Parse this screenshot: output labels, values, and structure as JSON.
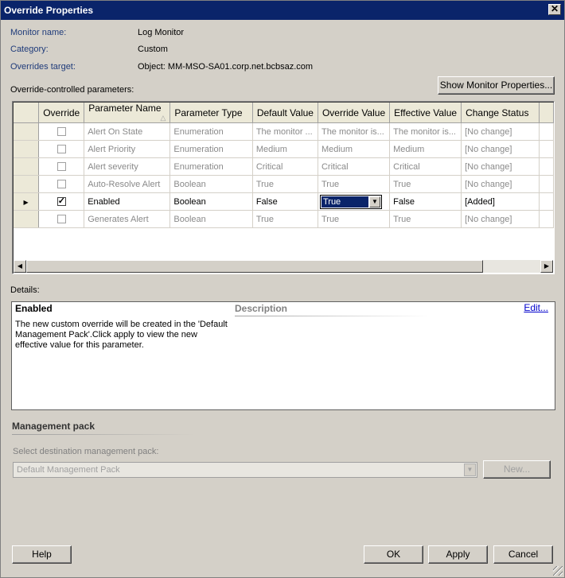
{
  "window": {
    "title": "Override Properties",
    "close_glyph": "✕"
  },
  "info": {
    "monitor_name_label": "Monitor name:",
    "monitor_name_value": "Log Monitor",
    "category_label": "Category:",
    "category_value": "Custom",
    "target_label": "Overrides target:",
    "target_value": "Object:  MM-MSO-SA01.corp.net.bcbsaz.com"
  },
  "params_label": "Override-controlled  parameters:",
  "show_monitor_button": "Show Monitor Properties...",
  "grid": {
    "columns": [
      "Override",
      "Parameter Name",
      "Parameter Type",
      "Default Value",
      "Override Value",
      "Effective Value",
      "Change Status"
    ],
    "sort_glyph": "△",
    "current_row_glyph": "▶",
    "rows": [
      {
        "checked": false,
        "name": "Alert On State",
        "type": "Enumeration",
        "default": "The monitor ...",
        "override": "The monitor is...",
        "effective": "The monitor is...",
        "status": "[No change]"
      },
      {
        "checked": false,
        "name": "Alert Priority",
        "type": "Enumeration",
        "default": "Medium",
        "override": "Medium",
        "effective": "Medium",
        "status": "[No change]"
      },
      {
        "checked": false,
        "name": "Alert severity",
        "type": "Enumeration",
        "default": "Critical",
        "override": "Critical",
        "effective": "Critical",
        "status": "[No change]"
      },
      {
        "checked": false,
        "name": "Auto-Resolve Alert",
        "type": "Boolean",
        "default": "True",
        "override": "True",
        "effective": "True",
        "status": "[No change]"
      },
      {
        "checked": true,
        "name": "Enabled",
        "type": "Boolean",
        "default": "False",
        "override": "True",
        "effective": "False",
        "status": "[Added]",
        "active": true
      },
      {
        "checked": false,
        "name": "Generates Alert",
        "type": "Boolean",
        "default": "True",
        "override": "True",
        "effective": "True",
        "status": "[No change]"
      }
    ]
  },
  "details": {
    "label": "Details:",
    "title": "Enabled",
    "description_header": "Description",
    "edit_link": "Edit...",
    "text": "The new custom override will be created in the 'Default Management Pack'.Click apply to view  the new effective value for this parameter."
  },
  "management_pack": {
    "title": "Management pack",
    "select_label": "Select destination management pack:",
    "selected": "Default Management Pack",
    "new_button": "New..."
  },
  "buttons": {
    "help": "Help",
    "ok": "OK",
    "apply": "Apply",
    "cancel": "Cancel"
  }
}
